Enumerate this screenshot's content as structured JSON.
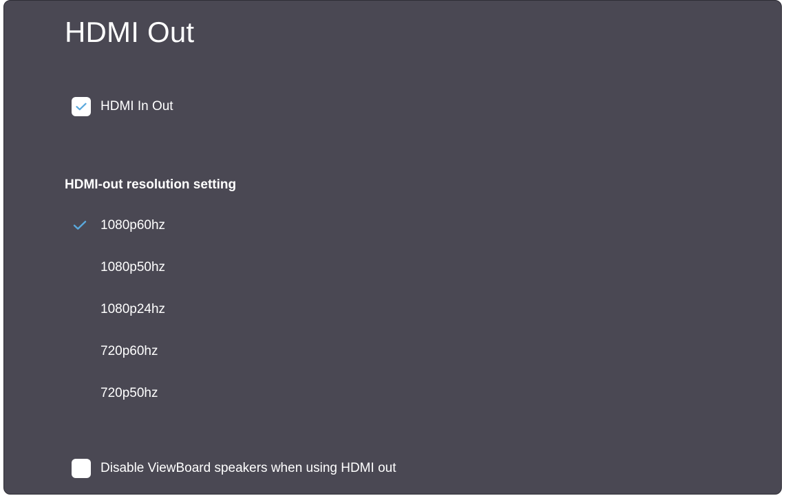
{
  "page": {
    "title": "HDMI Out"
  },
  "hdmi_in_out": {
    "label": "HDMI In Out",
    "checked": true,
    "check_color": "#5aa9dd",
    "icon": "checkmark-icon"
  },
  "resolution": {
    "heading": "HDMI-out resolution setting",
    "selected_index": 0,
    "tick_color": "#5aa9dd",
    "options": [
      {
        "label": "1080p60hz",
        "selected": true
      },
      {
        "label": "1080p50hz",
        "selected": false
      },
      {
        "label": "1080p24hz",
        "selected": false
      },
      {
        "label": "720p60hz",
        "selected": false
      },
      {
        "label": "720p50hz",
        "selected": false
      }
    ]
  },
  "disable_speakers": {
    "label": "Disable ViewBoard speakers when using HDMI out",
    "checked": false
  },
  "colors": {
    "panel_background": "#4a4853",
    "text": "#ffffff",
    "accent": "#5aa9dd"
  }
}
